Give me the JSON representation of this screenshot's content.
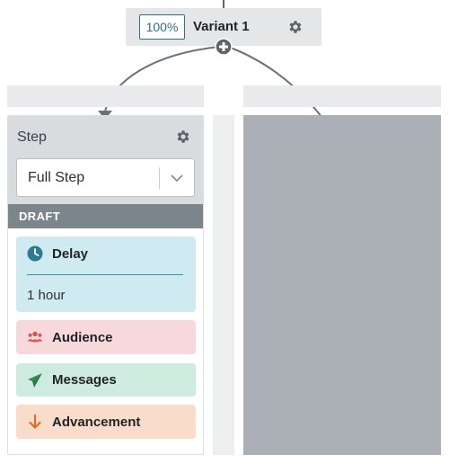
{
  "variant": {
    "percentage": "100%",
    "title": "Variant 1",
    "icons": {
      "settings": "gear-icon",
      "add": "plus-circle-icon"
    }
  },
  "step": {
    "title": "Step",
    "select": {
      "value": "Full Step",
      "icon": "chevron-down-icon"
    },
    "status": "DRAFT",
    "blocks": [
      {
        "label": "Delay",
        "value": "1 hour",
        "icon": "clock-icon",
        "color": "#cfeaf1"
      },
      {
        "label": "Audience",
        "icon": "users-icon",
        "color": "#f7d9dc"
      },
      {
        "label": "Messages",
        "icon": "paper-plane-icon",
        "color": "#cfeade"
      },
      {
        "label": "Advancement",
        "icon": "arrow-down-icon",
        "color": "#f9dcca"
      }
    ]
  },
  "colors": {
    "accent": "#2f6f8a",
    "draft_bar": "#7b858c",
    "placeholder_column": "#aab0b5",
    "connector": "#5f6368"
  }
}
